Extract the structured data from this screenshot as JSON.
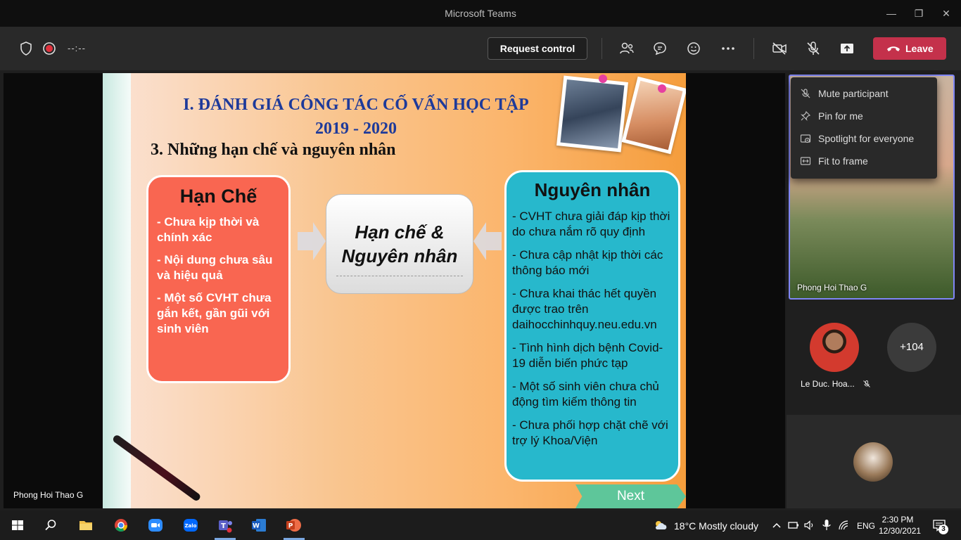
{
  "window": {
    "title": "Microsoft Teams"
  },
  "toolbar": {
    "timer": "--:--",
    "request_control": "Request control",
    "leave": "Leave"
  },
  "stage": {
    "presenter_name": "Phong Hoi Thao G"
  },
  "slide": {
    "heading_line1": "I. ĐÁNH GIÁ CÔNG TÁC CỐ VẤN HỌC TẬP",
    "heading_line2": "2019 - 2020",
    "subheading": "3. Những hạn chế và nguyên nhân",
    "left_box": {
      "title": "Hạn Chế",
      "items": [
        "- Chưa kịp thời và chính xác",
        "- Nội dung chưa sâu và hiệu quả",
        "- Một số CVHT chưa gắn kết, gần gũi với sinh viên"
      ]
    },
    "center_box": {
      "line1": "Hạn chế &",
      "line2": "Nguyên nhân"
    },
    "right_box": {
      "title": "Nguyên nhân",
      "items": [
        "- CVHT chưa giải đáp kịp thời do chưa nắm rõ quy định",
        "- Chưa cập nhật kịp thời các thông báo mới",
        "- Chưa khai thác hết quyền được trao trên daihocchinhquy.neu.edu.vn",
        "- Tình hình dịch bệnh Covid-19 diễn biến phức tạp",
        "- Một số sinh viên chưa chủ động tìm kiếm thông tin",
        "- Chưa phối hợp chặt chẽ với trợ lý Khoa/Viện"
      ]
    },
    "next": "Next"
  },
  "context_menu": {
    "items": [
      "Mute participant",
      "Pin for me",
      "Spotlight for everyone",
      "Fit to frame"
    ]
  },
  "sidebar": {
    "tile_name": "Phong Hoi Thao G",
    "participant_name": "Le Duc. Hoa...",
    "more_count": "+104"
  },
  "taskbar": {
    "weather": "18°C  Mostly cloudy",
    "lang": "ENG",
    "time": "2:30 PM",
    "date": "12/30/2021",
    "notifications": "3"
  },
  "colors": {
    "leave": "#c4314b",
    "accent": "#7f85f5",
    "teal_box": "#27b8cc",
    "red_box": "#f96651"
  }
}
